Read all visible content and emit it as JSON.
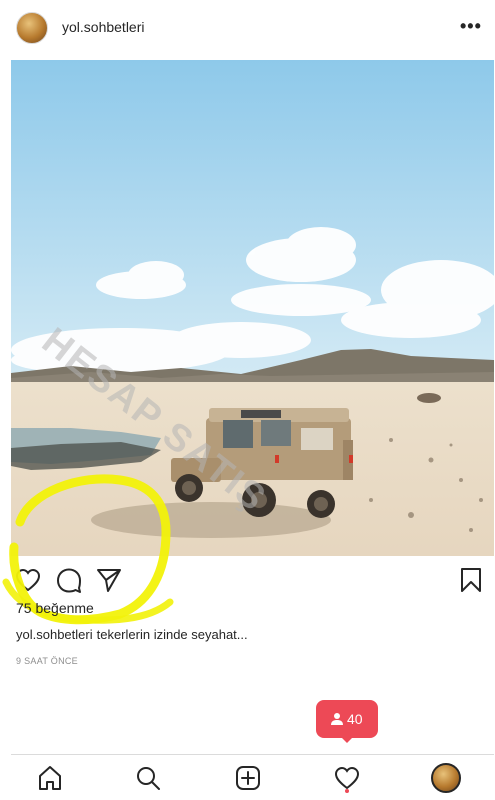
{
  "post": {
    "username": "yol.sohbetleri",
    "likes_text": "75 beğenme",
    "caption_user": "yol.sohbetleri",
    "caption_text": "tekerlerin izinde seyahat...",
    "time_text": "9 SAAT ÖNCE",
    "watermark": "HESAP SATIŞ"
  },
  "notification": {
    "count": "40"
  },
  "icons": {
    "more": "more-options-icon",
    "like": "heart-icon",
    "comment": "comment-icon",
    "share": "paper-plane-icon",
    "save": "bookmark-icon",
    "home": "home-icon",
    "search": "search-icon",
    "new_post": "add-post-icon",
    "activity": "heart-icon",
    "profile": "profile-avatar"
  },
  "colors": {
    "notification": "#ed4956",
    "highlight": "#f2f20a",
    "muted_text": "#8e8e8e"
  }
}
